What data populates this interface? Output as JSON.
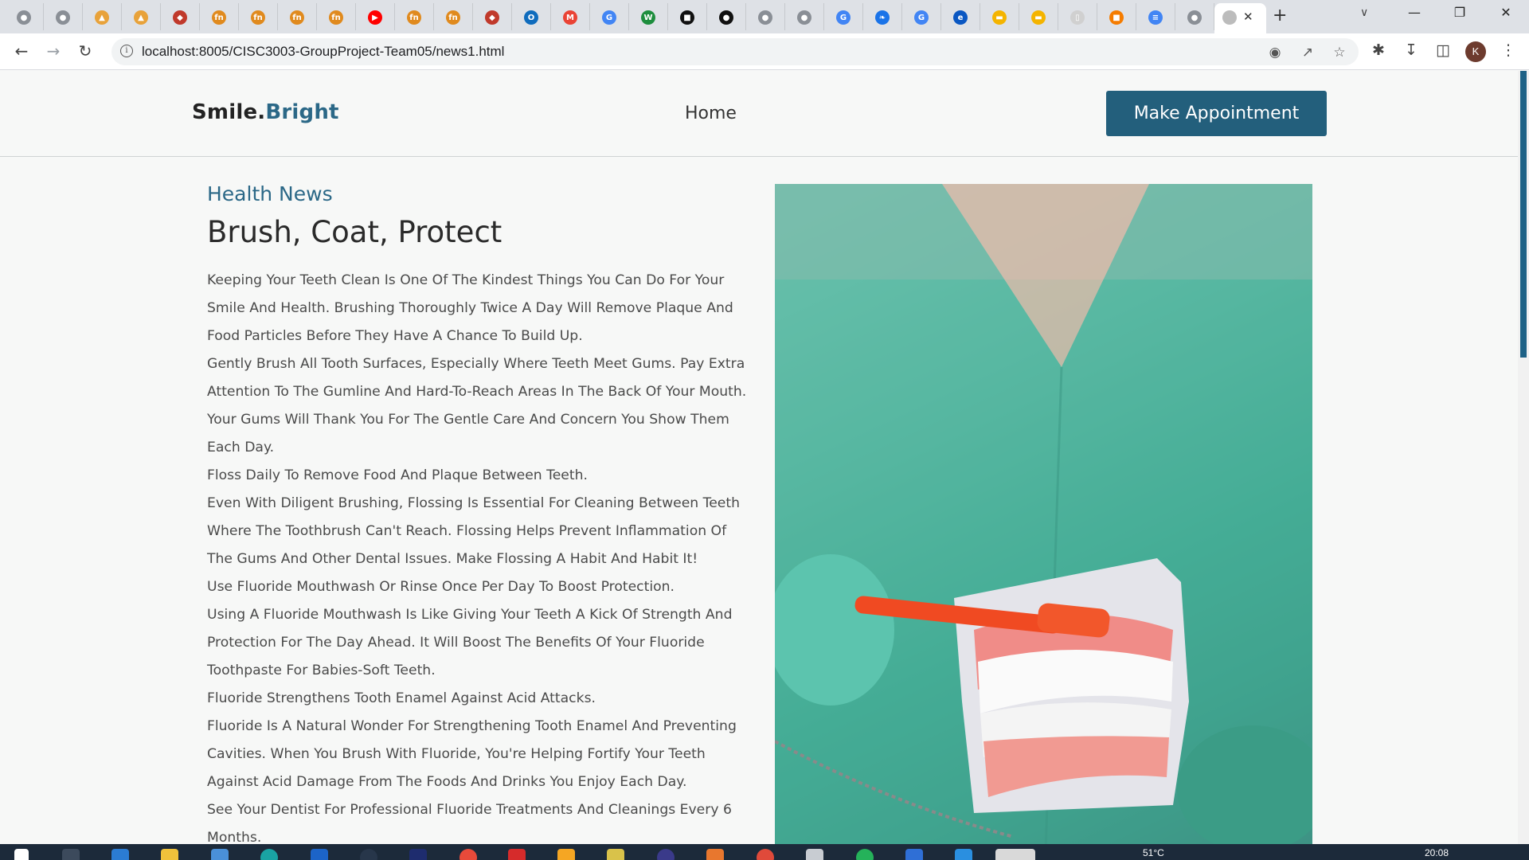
{
  "browser": {
    "url": "localhost:8005/CISC3003-GroupProject-Team05/news1.html",
    "profile_initial": "K",
    "tabs": [
      {
        "icon": "globe-icon",
        "color": "#8a8f96"
      },
      {
        "icon": "globe-icon",
        "color": "#8a8f96"
      },
      {
        "icon": "pma-icon",
        "color": "#e8a23a"
      },
      {
        "icon": "pma-icon",
        "color": "#e8a23a"
      },
      {
        "icon": "red-app-icon",
        "color": "#c0392b"
      },
      {
        "icon": "fn-icon",
        "color": "#e08a1e"
      },
      {
        "icon": "fn-icon",
        "color": "#e08a1e"
      },
      {
        "icon": "fn-icon",
        "color": "#e08a1e"
      },
      {
        "icon": "fn-icon",
        "color": "#e08a1e"
      },
      {
        "icon": "youtube-icon",
        "color": "#ff0000"
      },
      {
        "icon": "fn-icon",
        "color": "#e08a1e"
      },
      {
        "icon": "fn-icon",
        "color": "#e08a1e"
      },
      {
        "icon": "red-app-icon",
        "color": "#c0392b"
      },
      {
        "icon": "outlook-icon",
        "color": "#0f6cbd"
      },
      {
        "icon": "gmail-icon",
        "color": "#ea4335"
      },
      {
        "icon": "google-icon",
        "color": "#4285f4"
      },
      {
        "icon": "w-icon",
        "color": "#1e8e3e"
      },
      {
        "icon": "terminal-icon",
        "color": "#111111"
      },
      {
        "icon": "github-icon",
        "color": "#111111"
      },
      {
        "icon": "globe-icon",
        "color": "#8a8f96"
      },
      {
        "icon": "globe-icon",
        "color": "#8a8f96"
      },
      {
        "icon": "google-icon",
        "color": "#4285f4"
      },
      {
        "icon": "feather-icon",
        "color": "#1a73e8"
      },
      {
        "icon": "google-icon",
        "color": "#4285f4"
      },
      {
        "icon": "edge-icon",
        "color": "#0a57c2"
      },
      {
        "icon": "slides-icon",
        "color": "#f4b400"
      },
      {
        "icon": "slides-icon",
        "color": "#f4b400"
      },
      {
        "icon": "blank-page-icon",
        "color": "#d0d0d0"
      },
      {
        "icon": "puzzle-app-icon",
        "color": "#f57c00"
      },
      {
        "icon": "docs-icon",
        "color": "#4285f4"
      },
      {
        "icon": "globe-icon",
        "color": "#8a8f96"
      }
    ]
  },
  "site": {
    "logo_main": "Smile.",
    "logo_accent": "Bright",
    "nav_home": "Home",
    "cta": "Make Appointment"
  },
  "article": {
    "kicker": "Health News",
    "title": "Brush, Coat, Protect",
    "paragraphs": [
      "Keeping Your Teeth Clean Is One Of The Kindest Things You Can Do For Your Smile And Health. Brushing Thoroughly Twice A Day Will Remove Plaque And Food Particles Before They Have A Chance To Build Up.",
      "Gently Brush All Tooth Surfaces, Especially Where Teeth Meet Gums. Pay Extra Attention To The Gumline And Hard-To-Reach Areas In The Back Of Your Mouth. Your Gums Will Thank You For The Gentle Care And Concern You Show Them Each Day.",
      "Floss Daily To Remove Food And Plaque Between Teeth.",
      "Even With Diligent Brushing, Flossing Is Essential For Cleaning Between Teeth Where The Toothbrush Can't Reach. Flossing Helps Prevent Inflammation Of The Gums And Other Dental Issues. Make Flossing A Habit And Habit It!",
      "Use Fluoride Mouthwash Or Rinse Once Per Day To Boost Protection.",
      "Using A Fluoride Mouthwash Is Like Giving Your Teeth A Kick Of Strength And Protection For The Day Ahead. It Will Boost The Benefits Of Your Fluoride Toothpaste For Babies-Soft Teeth.",
      "Fluoride Strengthens Tooth Enamel Against Acid Attacks.",
      "Fluoride Is A Natural Wonder For Strengthening Tooth Enamel And Preventing Cavities. When You Brush With Fluoride, You're Helping Fortify Your Teeth Against Acid Damage From The Foods And Drinks You Enjoy Each Day.",
      "See Your Dentist For Professional Fluoride Treatments And Cleanings Every 6 Months."
    ]
  },
  "taskbar": {
    "weather": "51°C",
    "time": "20:08"
  }
}
